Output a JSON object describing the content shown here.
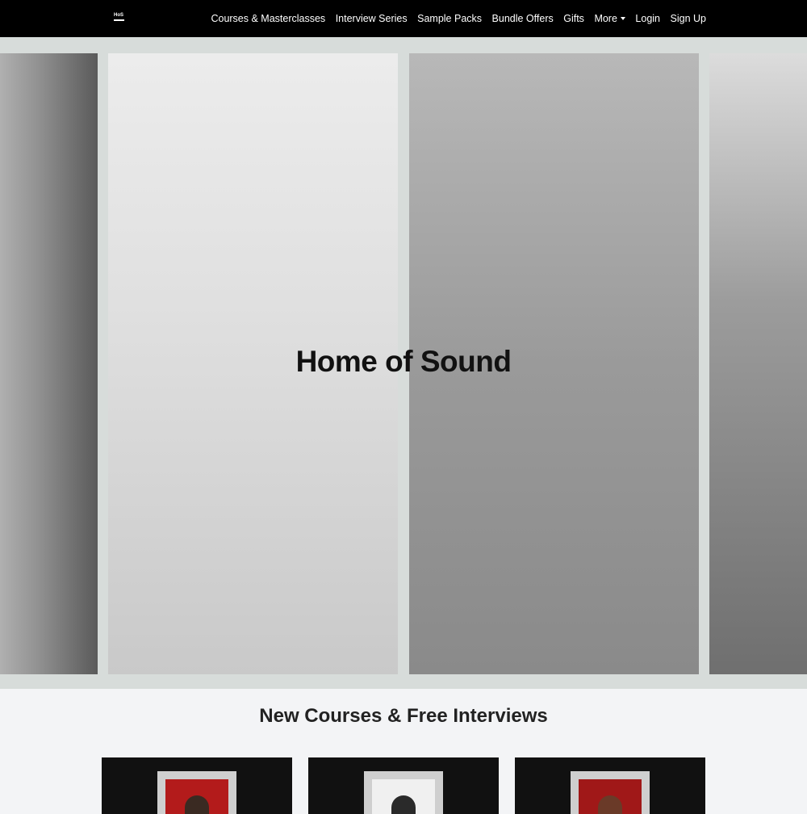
{
  "nav": {
    "logo_text": "HoS",
    "items": [
      {
        "label": "Courses & Masterclasses"
      },
      {
        "label": "Interview Series"
      },
      {
        "label": "Sample Packs"
      },
      {
        "label": "Bundle Offers"
      },
      {
        "label": "Gifts"
      },
      {
        "label": "More"
      },
      {
        "label": "Login"
      },
      {
        "label": "Sign Up"
      }
    ]
  },
  "hero": {
    "title": "Home of Sound"
  },
  "section": {
    "title": "New Courses & Free Interviews"
  }
}
